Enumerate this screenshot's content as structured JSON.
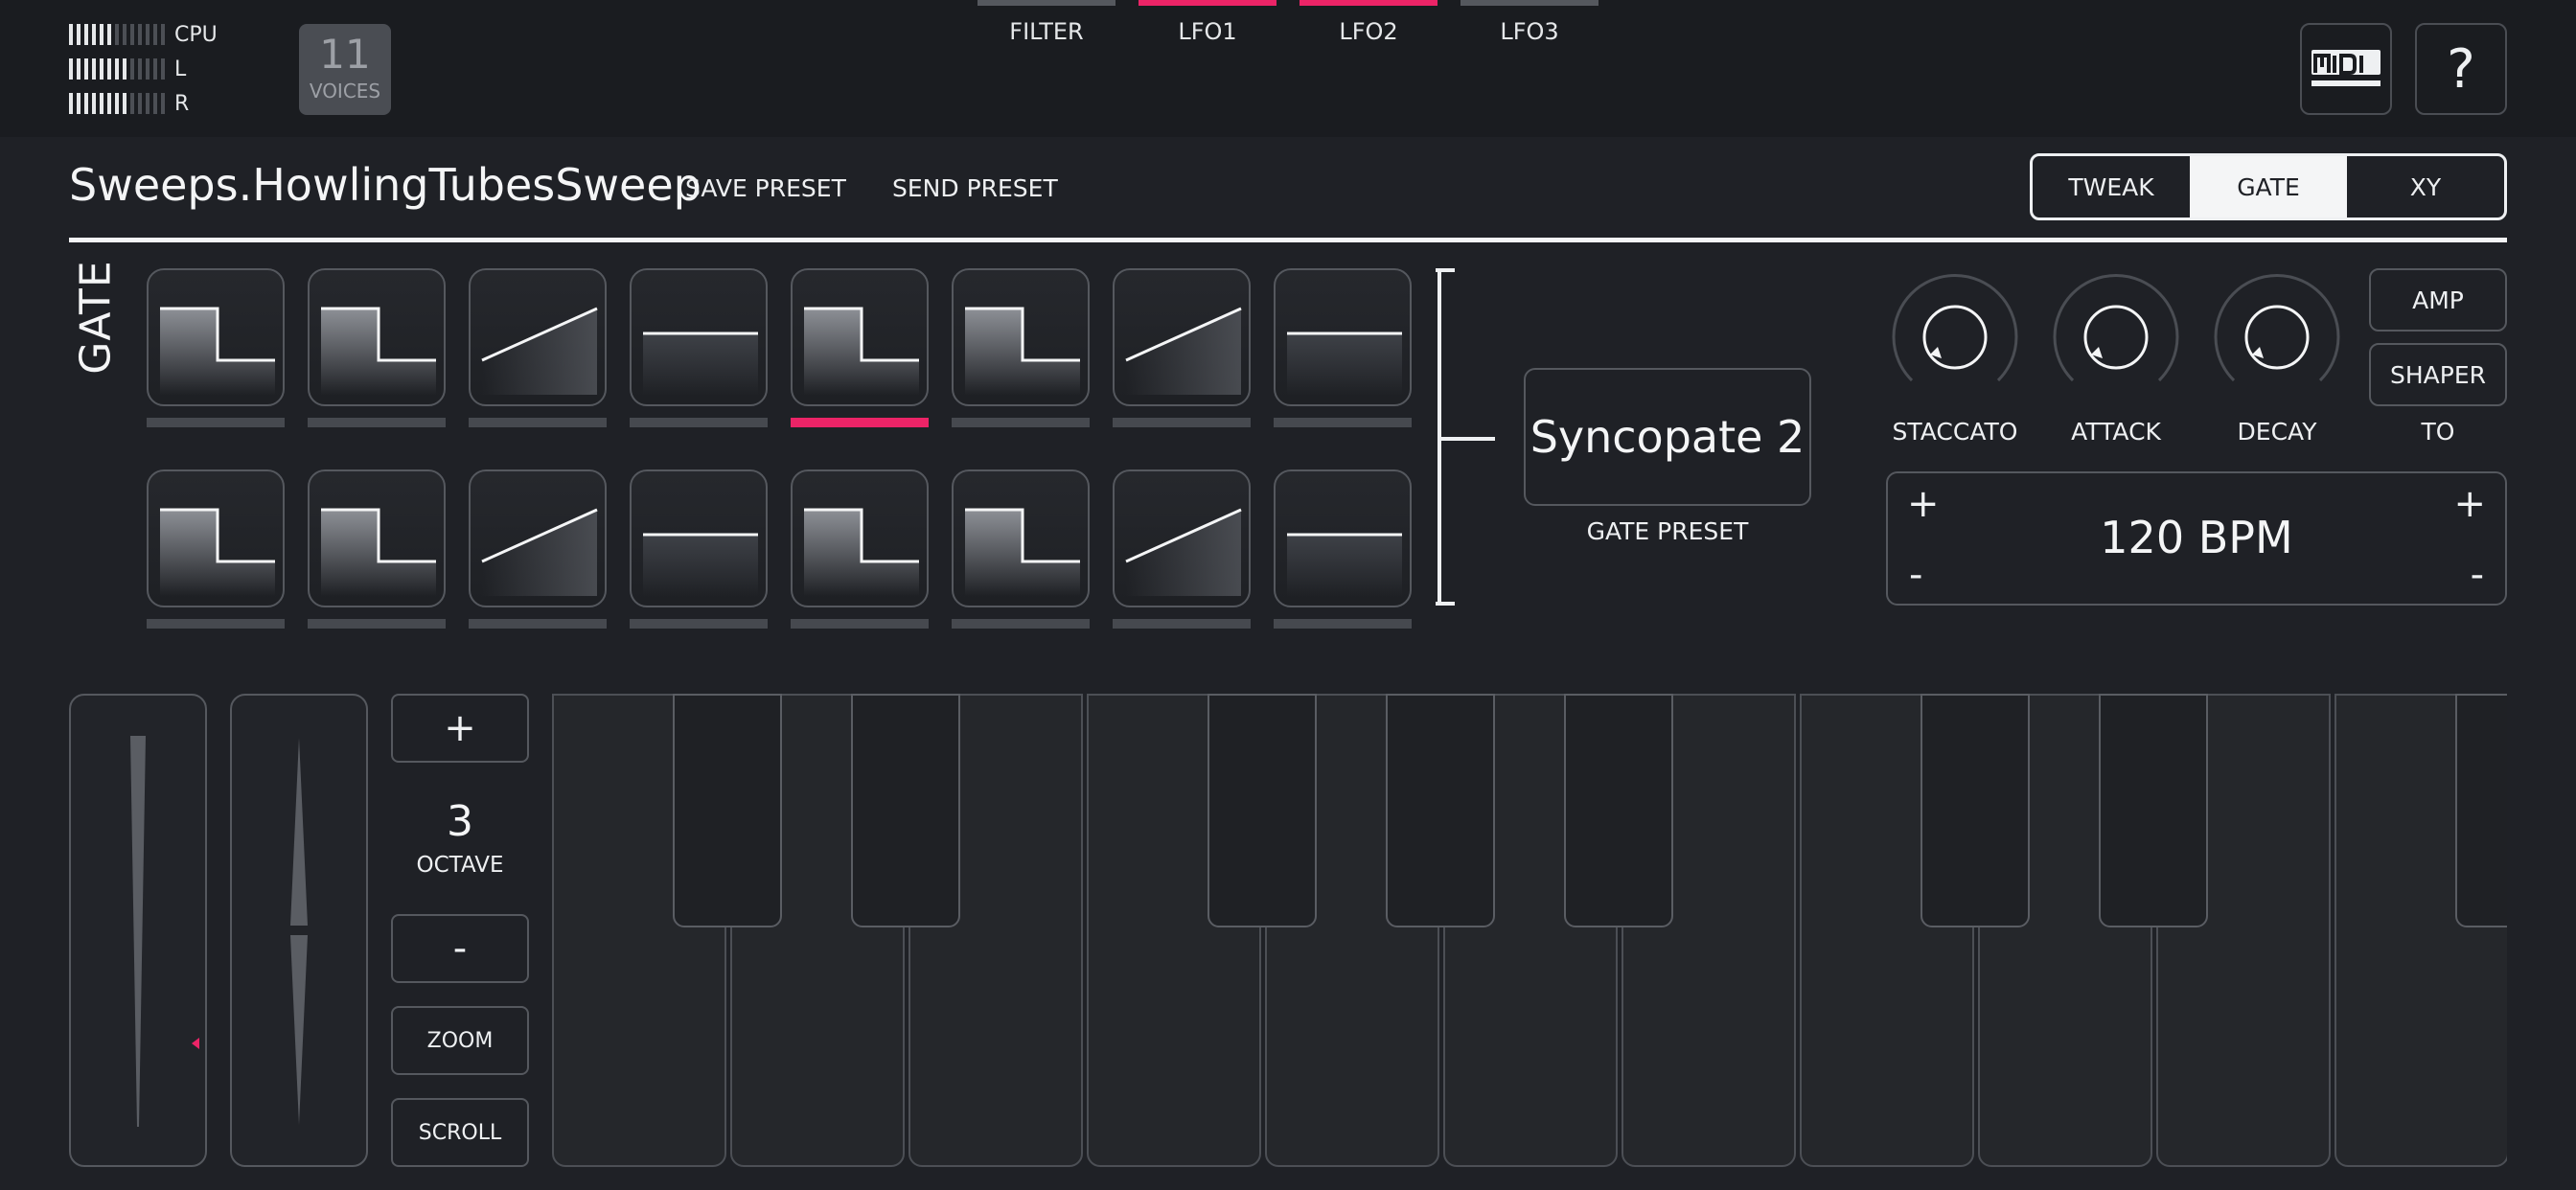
{
  "meters": [
    {
      "label": "CPU",
      "lit": 6,
      "total": 13
    },
    {
      "label": "L",
      "lit": 8,
      "total": 13
    },
    {
      "label": "R",
      "lit": 8,
      "total": 13
    }
  ],
  "voices": {
    "count": "11",
    "label": "VOICES"
  },
  "top_tabs": [
    {
      "label": "FILTER",
      "active": false
    },
    {
      "label": "LFO1",
      "active": true
    },
    {
      "label": "LFO2",
      "active": true
    },
    {
      "label": "LFO3",
      "active": false
    }
  ],
  "icons": {
    "midi": "midi-icon",
    "help": "?"
  },
  "preset": {
    "name": "Sweeps.HowlingTubesSweep",
    "save": "SAVE PRESET",
    "send": "SEND PRESET"
  },
  "modes": [
    {
      "label": "TWEAK",
      "active": false
    },
    {
      "label": "GATE",
      "active": true
    },
    {
      "label": "XY",
      "active": false
    }
  ],
  "gate": {
    "title": "GATE",
    "rows": [
      [
        "step-down",
        "step-down",
        "ramp-up",
        "flat",
        "step-down",
        "step-down",
        "ramp-up",
        "flat"
      ],
      [
        "step-down",
        "step-down",
        "ramp-up",
        "flat",
        "step-down",
        "step-down",
        "ramp-up",
        "flat"
      ]
    ],
    "active_step": 5,
    "preset_value": "Syncopate 2",
    "preset_label": "GATE PRESET"
  },
  "knobs": [
    {
      "label": "STACCATO"
    },
    {
      "label": "ATTACK"
    },
    {
      "label": "DECAY"
    }
  ],
  "side_buttons": {
    "amp": "AMP",
    "shaper": "SHAPER",
    "to_label": "TO"
  },
  "bpm": {
    "value": "120 BPM",
    "plus": "+",
    "minus": "-"
  },
  "octave": {
    "plus": "+",
    "value": "3",
    "label": "OCTAVE",
    "minus": "-",
    "zoom": "ZOOM",
    "scroll": "SCROLL"
  },
  "colors": {
    "accent": "#ec2467",
    "background": "#1f2126",
    "panel": "#1a1c20"
  }
}
